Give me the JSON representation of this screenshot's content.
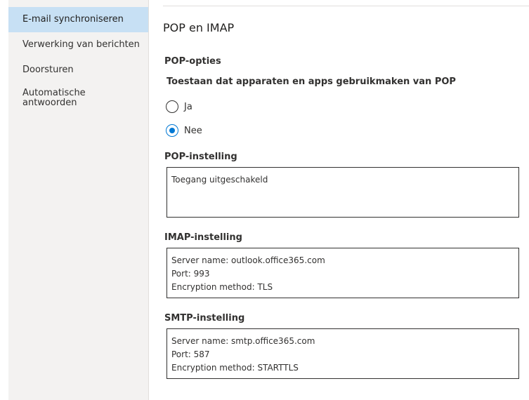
{
  "sidebar": {
    "items": [
      {
        "label": "E-mail synchroniseren",
        "selected": true
      },
      {
        "label": "Verwerking van berichten",
        "selected": false
      },
      {
        "label": "Doorsturen",
        "selected": false
      },
      {
        "label": "Automatische\nantwoorden",
        "selected": false
      }
    ]
  },
  "main": {
    "title": "POP en IMAP",
    "pop_options": {
      "heading": "POP-opties",
      "question": "Toestaan dat apparaten en apps gebruikmaken van POP",
      "options": [
        {
          "label": "Ja",
          "checked": false
        },
        {
          "label": "Nee",
          "checked": true
        }
      ]
    },
    "pop_setting": {
      "heading": "POP-instelling",
      "lines": [
        "Toegang uitgeschakeld"
      ]
    },
    "imap_setting": {
      "heading": "IMAP-instelling",
      "lines": [
        "Server name: outlook.office365.com",
        "Port: 993",
        "Encryption method: TLS"
      ]
    },
    "smtp_setting": {
      "heading": "SMTP-instelling",
      "lines": [
        "Server name: smtp.office365.com",
        "Port: 587",
        "Encryption method: STARTTLS"
      ]
    }
  },
  "colors": {
    "accent": "#0078d4",
    "selected_nav_bg": "#c7e0f4",
    "sidebar_bg": "#f3f2f1"
  }
}
